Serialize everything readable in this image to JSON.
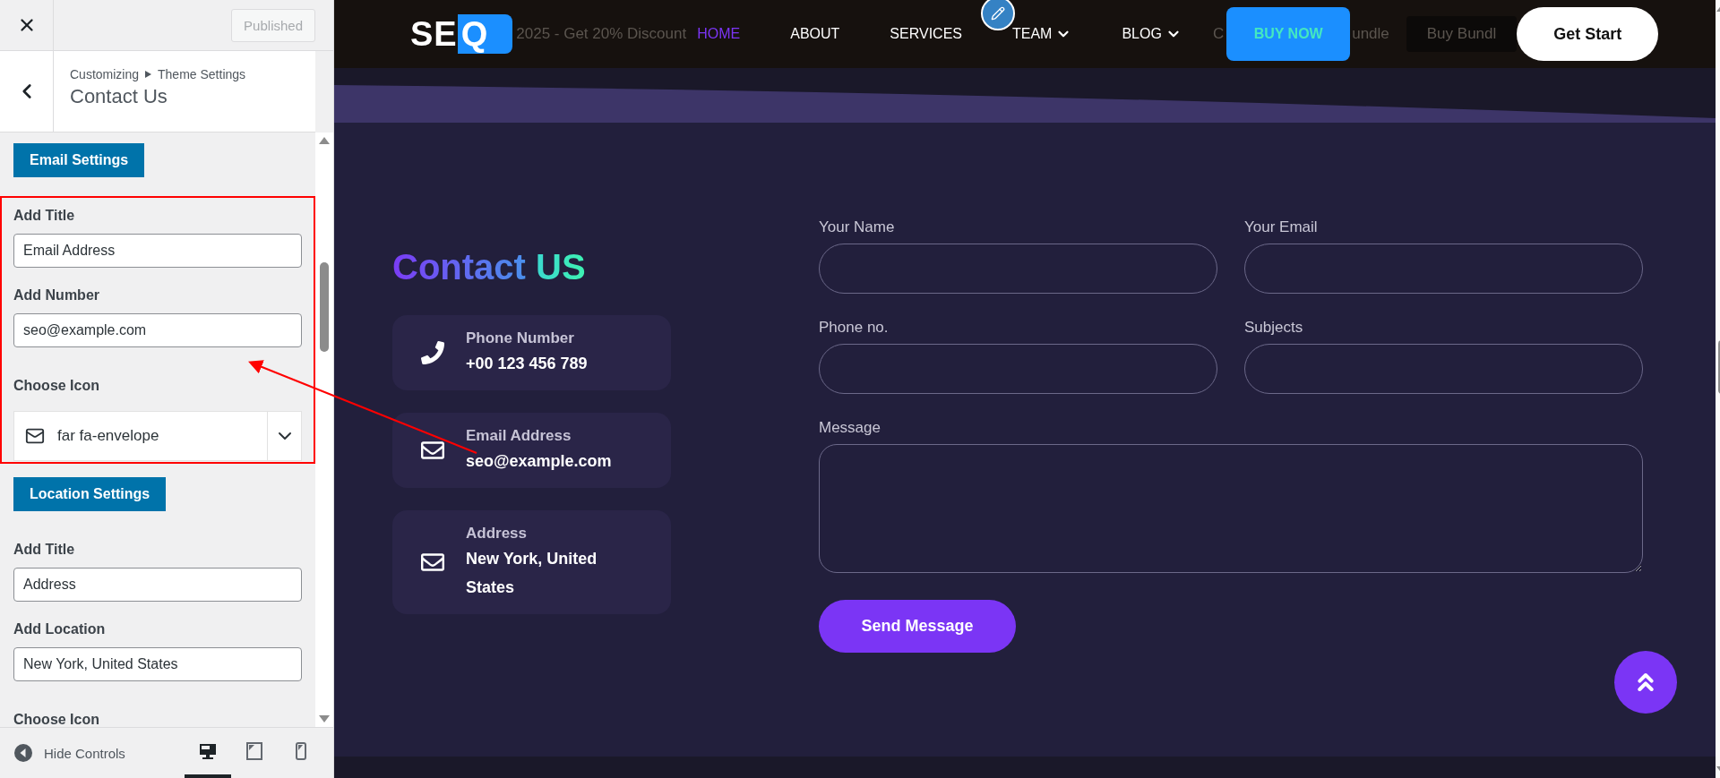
{
  "customizer": {
    "publish_button": "Published",
    "breadcrumb": [
      "Customizing",
      "Theme Settings"
    ],
    "title": "Contact Us",
    "sections": [
      {
        "heading": "Email Settings",
        "highlighted": true,
        "fields": [
          {
            "kind": "text",
            "label": "Add Title",
            "value": "Email Address"
          },
          {
            "kind": "text",
            "label": "Add Number",
            "value": "seo@example.com"
          },
          {
            "kind": "icon_select",
            "label": "Choose Icon",
            "value": "far fa-envelope"
          }
        ]
      },
      {
        "heading": "Location Settings",
        "highlighted": false,
        "fields": [
          {
            "kind": "text",
            "label": "Add Title",
            "value": "Address"
          },
          {
            "kind": "text",
            "label": "Add Location",
            "value": "New York, United States"
          },
          {
            "kind": "icon_select",
            "label": "Choose Icon"
          }
        ]
      }
    ],
    "footer": {
      "hide_controls": "Hide Controls",
      "devices": [
        {
          "kind": "desktop",
          "selected": true
        },
        {
          "kind": "tablet",
          "selected": false
        },
        {
          "kind": "mobile",
          "selected": false
        }
      ]
    }
  },
  "preview": {
    "banner": [
      {
        "kind": "text",
        "text": "2025 - Get 20% Discount"
      },
      {
        "kind": "text",
        "text": "C"
      },
      {
        "kind": "text",
        "text": "undle"
      },
      {
        "kind": "button",
        "text": "Buy Bundl"
      }
    ],
    "header": {
      "logo": {
        "text": "SE",
        "accent": "Q"
      },
      "nav": [
        {
          "label": "HOME",
          "selected": true,
          "dropdown": false
        },
        {
          "label": "ABOUT",
          "selected": false,
          "dropdown": false
        },
        {
          "label": "SERVICES",
          "selected": false,
          "dropdown": false
        },
        {
          "label": "TEAM",
          "selected": false,
          "dropdown": true
        },
        {
          "label": "BLOG",
          "selected": false,
          "dropdown": true
        }
      ],
      "buy_button": "BUY NOW",
      "start_button": "Get Start"
    },
    "contact": {
      "title": "Contact",
      "title_accent": "US",
      "cards": [
        {
          "kind": "phone",
          "label": "Phone Number",
          "value": "+00 123 456 789"
        },
        {
          "kind": "envelope",
          "label": "Email Address",
          "value": "seo@example.com"
        },
        {
          "kind": "envelope",
          "label": "Address",
          "value": "New York, United States"
        }
      ],
      "form": [
        {
          "kind": "input",
          "label": "Your Name"
        },
        {
          "kind": "input",
          "label": "Your Email"
        },
        {
          "kind": "input",
          "label": "Phone no."
        },
        {
          "kind": "input",
          "label": "Subjects"
        },
        {
          "kind": "textarea",
          "label": "Message"
        }
      ],
      "submit": "Send Message"
    }
  }
}
